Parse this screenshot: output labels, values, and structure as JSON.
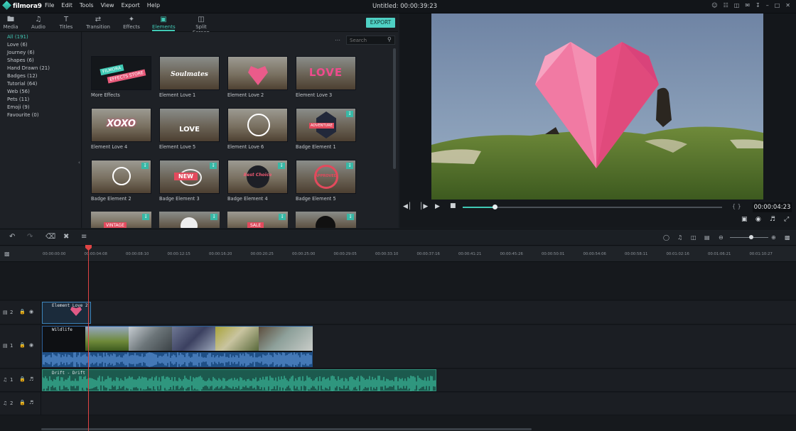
{
  "app": {
    "name": "filmora9",
    "window_title": "Untitled: 00:00:39:23"
  },
  "menu": [
    "File",
    "Edit",
    "Tools",
    "View",
    "Export",
    "Help"
  ],
  "window_icons": [
    "user-icon",
    "cart-icon",
    "gift-icon",
    "mail-icon",
    "download-icon",
    "minimize-icon",
    "maximize-icon",
    "close-icon"
  ],
  "tabs": [
    {
      "label": "Media",
      "icon": "folder-icon"
    },
    {
      "label": "Audio",
      "icon": "music-icon"
    },
    {
      "label": "Titles",
      "icon": "titles-icon"
    },
    {
      "label": "Transition",
      "icon": "transition-icon"
    },
    {
      "label": "Effects",
      "icon": "effects-icon"
    },
    {
      "label": "Elements",
      "icon": "elements-icon",
      "active": true
    },
    {
      "label": "Split Screen",
      "icon": "split-screen-icon"
    }
  ],
  "export_label": "EXPORT",
  "categories": [
    "All (191)",
    "Love (6)",
    "Journey (6)",
    "Shapes (6)",
    "Hand Drawn (21)",
    "Badges (12)",
    "Tutorial (64)",
    "Web (56)",
    "Pets (11)",
    "Emoji (9)",
    "Favourite (0)"
  ],
  "search": {
    "placeholder": "Search"
  },
  "thumb_texts": {
    "more_effects_line1": "FILMORA",
    "more_effects_line2": "EFFECTS STORE",
    "soulmates": "Soulmates",
    "love": "LOVE",
    "xoxo": "XOXO",
    "love5": "LOVE",
    "adventure": "ADVENTURE",
    "new": "NEW",
    "best_choice": "Best Choice",
    "approved": "APPROVED",
    "vintage": "VINTAGE",
    "sale": "SALE"
  },
  "elements": [
    {
      "label": "More Effects"
    },
    {
      "label": "Element Love 1"
    },
    {
      "label": "Element Love 2"
    },
    {
      "label": "Element Love 3"
    },
    {
      "label": "Element Love 4"
    },
    {
      "label": "Element Love 5"
    },
    {
      "label": "Element Love 6"
    },
    {
      "label": "Badge Element 1"
    },
    {
      "label": "Badge Element 2"
    },
    {
      "label": "Badge Element 3"
    },
    {
      "label": "Badge Element 4"
    },
    {
      "label": "Badge Element 5"
    }
  ],
  "player": {
    "timecode": "00:00:04:23",
    "braces": "{ }",
    "progress": 0.13
  },
  "ruler_ticks": [
    "00:00:00:00",
    "00:00:04:08",
    "00:00:08:10",
    "00:00:12:15",
    "00:00:16:20",
    "00:00:20:25",
    "00:00:25:00",
    "00:00:29:05",
    "00:00:33:10",
    "00:00:37:16",
    "00:00:41:21",
    "00:00:45:26",
    "00:00:50:01",
    "00:00:54:06",
    "00:00:58:11",
    "00:01:02:16",
    "00:01:06:21",
    "00:01:10:27"
  ],
  "tracks": {
    "video2_label": "2",
    "video1_label": "1",
    "audio1_label": "1",
    "audio2_label": "2",
    "clip_element": "Element Love 2",
    "clip_video": "Wildlife",
    "clip_audio": "Drift - Drift"
  },
  "colors": {
    "accent": "#41c9b5",
    "export": "#4fd1c5",
    "playhead": "#e04444",
    "audio_wave": "#3cbf9f",
    "video_audio_wave": "#3f6fae"
  }
}
